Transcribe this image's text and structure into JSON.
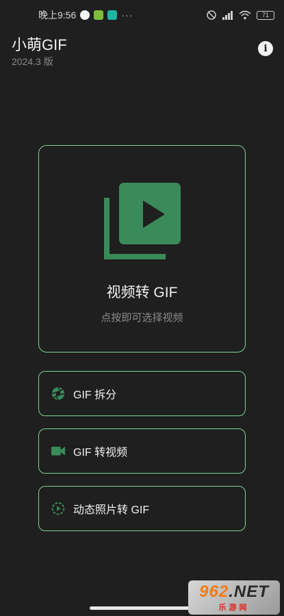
{
  "status_bar": {
    "time": "晚上9:56",
    "dots": "···",
    "battery": "71"
  },
  "header": {
    "title": "小萌GIF",
    "version": "2024.3 版",
    "info_icon": "info-icon"
  },
  "main_card": {
    "icon": "video-library-icon",
    "title": "视频转 GIF",
    "subtitle": "点按即可选择视频"
  },
  "options": [
    {
      "icon": "aperture-icon",
      "label": "GIF 拆分"
    },
    {
      "icon": "videocam-icon",
      "label": "GIF 转视频"
    },
    {
      "icon": "motion-photo-icon",
      "label": "动态照片转 GIF"
    }
  ],
  "colors": {
    "background": "#1e1f1e",
    "accent_border": "#7ed39a",
    "icon_green": "#3a8a5a"
  },
  "watermark": {
    "main_digits": "962",
    "main_suffix": ".NET",
    "sub": "乐游网"
  }
}
